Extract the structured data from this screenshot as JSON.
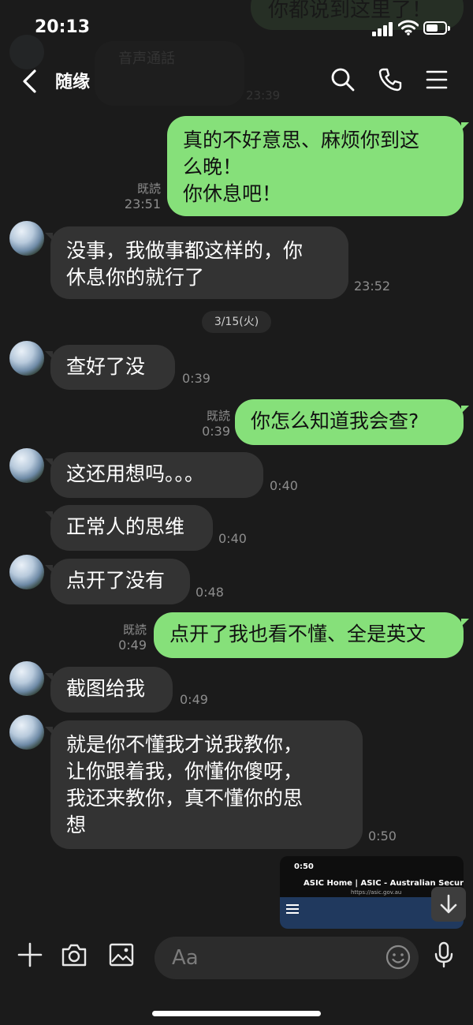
{
  "status_bar": {
    "time": "20:13"
  },
  "ghost": {
    "green_text": "你都说到这里了！",
    "call_label": "音声通話",
    "time": "23:39"
  },
  "header": {
    "title": "随缘"
  },
  "date_separator": "3/15(火)",
  "messages": [
    {
      "side": "out",
      "text": "真的不好意思、麻烦你到这\n么晚！\n你休息吧！",
      "read": "既読",
      "time": "23:51"
    },
    {
      "side": "in",
      "text": "没事，我做事都这样的，你\n休息你的就行了",
      "time": "23:52"
    },
    {
      "side": "in",
      "text": "查好了没",
      "time": "0:39"
    },
    {
      "side": "out",
      "text": "你怎么知道我会查?",
      "read": "既読",
      "time": "0:39"
    },
    {
      "side": "in",
      "text": "这还用想吗。。。",
      "time": "0:40"
    },
    {
      "side": "in",
      "text": "正常人的思维",
      "time": "0:40"
    },
    {
      "side": "in",
      "text": "点开了没有",
      "time": "0:48"
    },
    {
      "side": "out",
      "text": "点开了我也看不懂、全是英文",
      "read": "既読",
      "time": "0:49"
    },
    {
      "side": "in",
      "text": "截图给我",
      "time": "0:49"
    },
    {
      "side": "in",
      "text": "就是你不懂我才说我教你，\n让你跟着我，你懂你傻呀，\n我还来教你，真不懂你的思\n想",
      "time": "0:50"
    }
  ],
  "screenshot_thumb": {
    "time": "0:50",
    "title": "ASIC Home | ASIC - Australian Securitie...",
    "url": "https://asic.gov.au"
  },
  "input": {
    "placeholder": "Aa"
  },
  "colors": {
    "background": "#1b1b1b",
    "incoming_bubble": "#333333",
    "outgoing_bubble": "#86e07a",
    "meta_text": "#8d8d8d"
  },
  "icons": [
    "back-icon",
    "search-icon",
    "phone-icon",
    "menu-icon",
    "plus-icon",
    "camera-icon",
    "image-icon",
    "emoji-icon",
    "microphone-icon",
    "arrow-down-icon"
  ]
}
